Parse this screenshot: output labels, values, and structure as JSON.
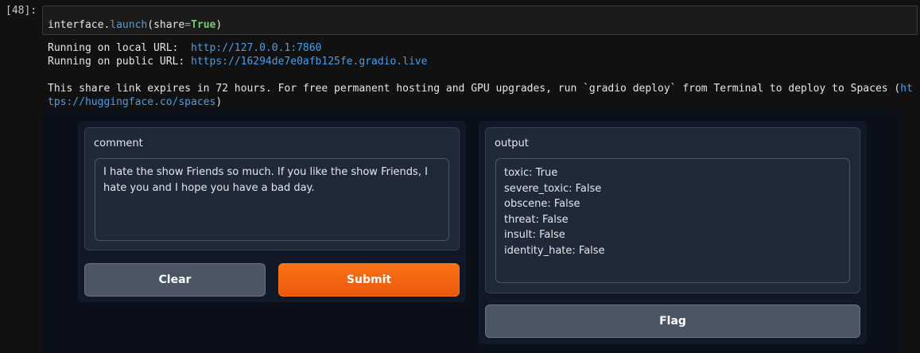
{
  "cell": {
    "prompt": "[48]:",
    "code": {
      "object": "interface.",
      "method": "launch",
      "open": "(",
      "arg": "share",
      "eq": "=",
      "value": "True",
      "close": ")"
    }
  },
  "output": {
    "local_label": "Running on local URL:  ",
    "local_url": "http://127.0.0.1:7860",
    "public_label": "Running on public URL: ",
    "public_url": "https://16294de7e0afb125fe.gradio.live",
    "notice_line1": "This share link expires in 72 hours. For free permanent hosting and GPU upgrades, run `gradio deploy` from Terminal to deploy to Spaces (",
    "notice_link1": "ht",
    "notice_link2": "tps://huggingface.co/spaces",
    "notice_close": ")"
  },
  "gradio": {
    "input_label": "comment",
    "input_value": "I hate the show Friends so much. If you like the show Friends, I hate you and I hope you have a bad day.",
    "clear_label": "Clear",
    "submit_label": "Submit",
    "output_label": "output",
    "output_lines": [
      "toxic: True",
      "severe_toxic: False",
      "obscene: False",
      "threat: False",
      "insult: False",
      "identity_hate: False"
    ],
    "flag_label": "Flag"
  }
}
